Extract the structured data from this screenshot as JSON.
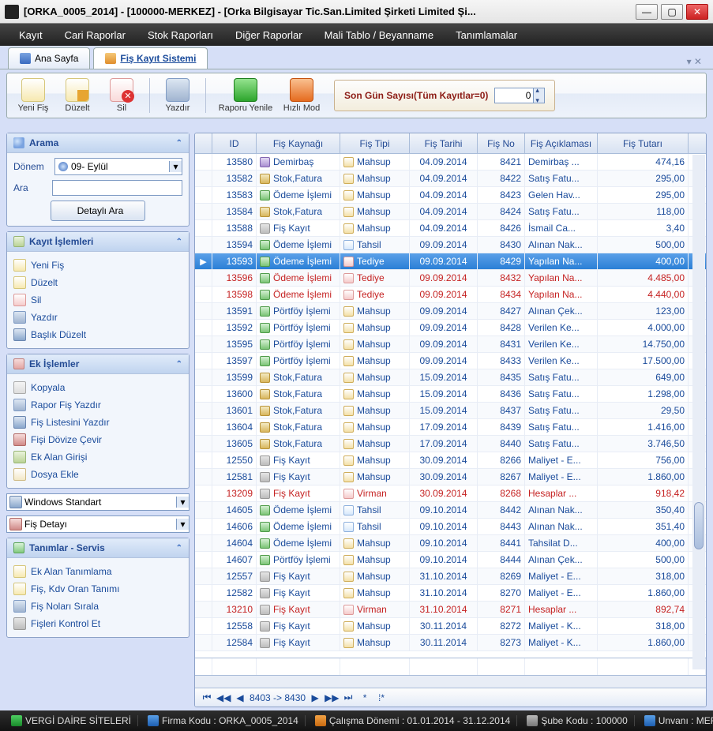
{
  "window": {
    "title": "[ORKA_0005_2014]    -    [100000-MERKEZ]    -    [Orka Bilgisayar Tic.San.Limited Şirketi  Limited Şi..."
  },
  "menu": [
    "Kayıt",
    "Cari Raporlar",
    "Stok Raporları",
    "Diğer Raporlar",
    "Mali Tablo / Beyanname",
    "Tanımlamalar"
  ],
  "tabs": [
    {
      "label": "Ana Sayfa",
      "active": false
    },
    {
      "label": "Fiş Kayıt Sistemi",
      "active": true
    }
  ],
  "toolbar": {
    "yeni": "Yeni Fiş",
    "duzelt": "Düzelt",
    "sil": "Sil",
    "yazdir": "Yazdır",
    "yenile": "Raporu Yenile",
    "hizli": "Hızlı Mod",
    "son_label": "Son Gün Sayısı(Tüm Kayıtlar=0)",
    "son_value": "0"
  },
  "search": {
    "title": "Arama",
    "donem_label": "Dönem",
    "donem_value": "09- Eylül",
    "ara_label": "Ara",
    "ara_value": "",
    "detayli": "Detaylı Ara"
  },
  "kayit": {
    "title": "Kayıt İşlemleri",
    "items": [
      "Yeni Fiş",
      "Düzelt",
      "Sil",
      "Yazdır",
      "Başlık Düzelt"
    ]
  },
  "ek": {
    "title": "Ek İşlemler",
    "items": [
      "Kopyala",
      "Rapor Fiş Yazdır",
      "Fiş Listesini Yazdır",
      "Fişi Dövize Çevir",
      "Ek Alan Girişi",
      "Dosya Ekle"
    ]
  },
  "combo1": "Windows Standart",
  "combo2": "Fiş Detayı",
  "tanim": {
    "title": "Tanımlar - Servis",
    "items": [
      "Ek Alan Tanımlama",
      "Fiş, Kdv Oran Tanımı",
      "Fiş Noları Sırala",
      "Fişleri Kontrol Et"
    ]
  },
  "grid": {
    "headers": {
      "id": "ID",
      "kaynak": "Fiş Kaynağı",
      "tip": "Fiş Tipi",
      "tarih": "Fiş Tarihi",
      "no": "Fiş No",
      "aciklama": "Fiş Açıklaması",
      "tutar": "Fiş Tutarı"
    },
    "rows": [
      {
        "id": "13580",
        "kIcon": "ic-k-demir",
        "k": "Demirbaş",
        "tIcon": "ic-t-mahsup",
        "t": "Mahsup",
        "dt": "04.09.2014",
        "no": "8421",
        "a": "Demirbaş ...",
        "tut": "474,16"
      },
      {
        "id": "13582",
        "kIcon": "ic-k-stok",
        "k": "Stok,Fatura",
        "tIcon": "ic-t-mahsup",
        "t": "Mahsup",
        "dt": "04.09.2014",
        "no": "8422",
        "a": "Satış Fatu...",
        "tut": "295,00"
      },
      {
        "id": "13583",
        "kIcon": "ic-k-odeme",
        "k": "Ödeme İşlemi",
        "tIcon": "ic-t-mahsup",
        "t": "Mahsup",
        "dt": "04.09.2014",
        "no": "8423",
        "a": "Gelen Hav...",
        "tut": "295,00"
      },
      {
        "id": "13584",
        "kIcon": "ic-k-stok",
        "k": "Stok,Fatura",
        "tIcon": "ic-t-mahsup",
        "t": "Mahsup",
        "dt": "04.09.2014",
        "no": "8424",
        "a": "Satış Fatu...",
        "tut": "118,00"
      },
      {
        "id": "13588",
        "kIcon": "ic-k-fis",
        "k": "Fiş Kayıt",
        "tIcon": "ic-t-mahsup",
        "t": "Mahsup",
        "dt": "04.09.2014",
        "no": "8426",
        "a": "İsmail Ca...",
        "tut": "3,40"
      },
      {
        "id": "13594",
        "kIcon": "ic-k-odeme",
        "k": "Ödeme İşlemi",
        "tIcon": "ic-t-tahsil",
        "t": "Tahsil",
        "dt": "09.09.2014",
        "no": "8430",
        "a": "Alınan Nak...",
        "tut": "500,00"
      },
      {
        "id": "13593",
        "kIcon": "ic-k-odeme",
        "k": "Ödeme İşlemi",
        "tIcon": "ic-t-tediye",
        "t": "Tediye",
        "dt": "09.09.2014",
        "no": "8429",
        "a": "Yapılan Na...",
        "tut": "400,00",
        "sel": true
      },
      {
        "id": "13596",
        "kIcon": "ic-k-odeme",
        "k": "Ödeme İşlemi",
        "tIcon": "ic-t-tediye",
        "t": "Tediye",
        "dt": "09.09.2014",
        "no": "8432",
        "a": "Yapılan Na...",
        "tut": "4.485,00",
        "red": true
      },
      {
        "id": "13598",
        "kIcon": "ic-k-odeme",
        "k": "Ödeme İşlemi",
        "tIcon": "ic-t-tediye",
        "t": "Tediye",
        "dt": "09.09.2014",
        "no": "8434",
        "a": "Yapılan Na...",
        "tut": "4.440,00",
        "red": true
      },
      {
        "id": "13591",
        "kIcon": "ic-k-port",
        "k": "Pörtföy İşlemi",
        "tIcon": "ic-t-mahsup",
        "t": "Mahsup",
        "dt": "09.09.2014",
        "no": "8427",
        "a": "Alınan Çek...",
        "tut": "123,00"
      },
      {
        "id": "13592",
        "kIcon": "ic-k-port",
        "k": "Pörtföy İşlemi",
        "tIcon": "ic-t-mahsup",
        "t": "Mahsup",
        "dt": "09.09.2014",
        "no": "8428",
        "a": "Verilen Ke...",
        "tut": "4.000,00"
      },
      {
        "id": "13595",
        "kIcon": "ic-k-port",
        "k": "Pörtföy İşlemi",
        "tIcon": "ic-t-mahsup",
        "t": "Mahsup",
        "dt": "09.09.2014",
        "no": "8431",
        "a": "Verilen Ke...",
        "tut": "14.750,00"
      },
      {
        "id": "13597",
        "kIcon": "ic-k-port",
        "k": "Pörtföy İşlemi",
        "tIcon": "ic-t-mahsup",
        "t": "Mahsup",
        "dt": "09.09.2014",
        "no": "8433",
        "a": "Verilen Ke...",
        "tut": "17.500,00"
      },
      {
        "id": "13599",
        "kIcon": "ic-k-stok",
        "k": "Stok,Fatura",
        "tIcon": "ic-t-mahsup",
        "t": "Mahsup",
        "dt": "15.09.2014",
        "no": "8435",
        "a": "Satış Fatu...",
        "tut": "649,00"
      },
      {
        "id": "13600",
        "kIcon": "ic-k-stok",
        "k": "Stok,Fatura",
        "tIcon": "ic-t-mahsup",
        "t": "Mahsup",
        "dt": "15.09.2014",
        "no": "8436",
        "a": "Satış Fatu...",
        "tut": "1.298,00"
      },
      {
        "id": "13601",
        "kIcon": "ic-k-stok",
        "k": "Stok,Fatura",
        "tIcon": "ic-t-mahsup",
        "t": "Mahsup",
        "dt": "15.09.2014",
        "no": "8437",
        "a": "Satış Fatu...",
        "tut": "29,50"
      },
      {
        "id": "13604",
        "kIcon": "ic-k-stok",
        "k": "Stok,Fatura",
        "tIcon": "ic-t-mahsup",
        "t": "Mahsup",
        "dt": "17.09.2014",
        "no": "8439",
        "a": "Satış Fatu...",
        "tut": "1.416,00"
      },
      {
        "id": "13605",
        "kIcon": "ic-k-stok",
        "k": "Stok,Fatura",
        "tIcon": "ic-t-mahsup",
        "t": "Mahsup",
        "dt": "17.09.2014",
        "no": "8440",
        "a": "Satış Fatu...",
        "tut": "3.746,50"
      },
      {
        "id": "12550",
        "kIcon": "ic-k-fis",
        "k": "Fiş Kayıt",
        "tIcon": "ic-t-mahsup",
        "t": "Mahsup",
        "dt": "30.09.2014",
        "no": "8266",
        "a": "Maliyet - E...",
        "tut": "756,00"
      },
      {
        "id": "12581",
        "kIcon": "ic-k-fis",
        "k": "Fiş Kayıt",
        "tIcon": "ic-t-mahsup",
        "t": "Mahsup",
        "dt": "30.09.2014",
        "no": "8267",
        "a": "Maliyet - E...",
        "tut": "1.860,00"
      },
      {
        "id": "13209",
        "kIcon": "ic-k-fis",
        "k": "Fiş Kayıt",
        "tIcon": "ic-t-virman",
        "t": "Virman",
        "dt": "30.09.2014",
        "no": "8268",
        "a": "Hesaplar ...",
        "tut": "918,42",
        "red": true
      },
      {
        "id": "14605",
        "kIcon": "ic-k-odeme",
        "k": "Ödeme İşlemi",
        "tIcon": "ic-t-tahsil",
        "t": "Tahsil",
        "dt": "09.10.2014",
        "no": "8442",
        "a": "Alınan Nak...",
        "tut": "350,40"
      },
      {
        "id": "14606",
        "kIcon": "ic-k-odeme",
        "k": "Ödeme İşlemi",
        "tIcon": "ic-t-tahsil",
        "t": "Tahsil",
        "dt": "09.10.2014",
        "no": "8443",
        "a": "Alınan Nak...",
        "tut": "351,40"
      },
      {
        "id": "14604",
        "kIcon": "ic-k-odeme",
        "k": "Ödeme İşlemi",
        "tIcon": "ic-t-mahsup",
        "t": "Mahsup",
        "dt": "09.10.2014",
        "no": "8441",
        "a": "Tahsilat D...",
        "tut": "400,00"
      },
      {
        "id": "14607",
        "kIcon": "ic-k-port",
        "k": "Pörtföy İşlemi",
        "tIcon": "ic-t-mahsup",
        "t": "Mahsup",
        "dt": "09.10.2014",
        "no": "8444",
        "a": "Alınan Çek...",
        "tut": "500,00"
      },
      {
        "id": "12557",
        "kIcon": "ic-k-fis",
        "k": "Fiş Kayıt",
        "tIcon": "ic-t-mahsup",
        "t": "Mahsup",
        "dt": "31.10.2014",
        "no": "8269",
        "a": "Maliyet - E...",
        "tut": "318,00"
      },
      {
        "id": "12582",
        "kIcon": "ic-k-fis",
        "k": "Fiş Kayıt",
        "tIcon": "ic-t-mahsup",
        "t": "Mahsup",
        "dt": "31.10.2014",
        "no": "8270",
        "a": "Maliyet - E...",
        "tut": "1.860,00"
      },
      {
        "id": "13210",
        "kIcon": "ic-k-fis",
        "k": "Fiş Kayıt",
        "tIcon": "ic-t-virman",
        "t": "Virman",
        "dt": "31.10.2014",
        "no": "8271",
        "a": "Hesaplar ...",
        "tut": "892,74",
        "red": true
      },
      {
        "id": "12558",
        "kIcon": "ic-k-fis",
        "k": "Fiş Kayıt",
        "tIcon": "ic-t-mahsup",
        "t": "Mahsup",
        "dt": "30.11.2014",
        "no": "8272",
        "a": "Maliyet - K...",
        "tut": "318,00"
      },
      {
        "id": "12584",
        "kIcon": "ic-k-fis",
        "k": "Fiş Kayıt",
        "tIcon": "ic-t-mahsup",
        "t": "Mahsup",
        "dt": "30.11.2014",
        "no": "8273",
        "a": "Maliyet - K...",
        "tut": "1.860,00"
      }
    ],
    "pager": "8403 -> 8430"
  },
  "status": {
    "s1": "VERGİ DAİRE SİTELERİ",
    "s2": "Firma Kodu : ORKA_0005_2014",
    "s3": "Çalışma Dönemi : 01.01.2014 - 31.12.2014",
    "s4": "Şube Kodu : 100000",
    "s5": "Unvanı : MERKEZ Orka B ..."
  }
}
